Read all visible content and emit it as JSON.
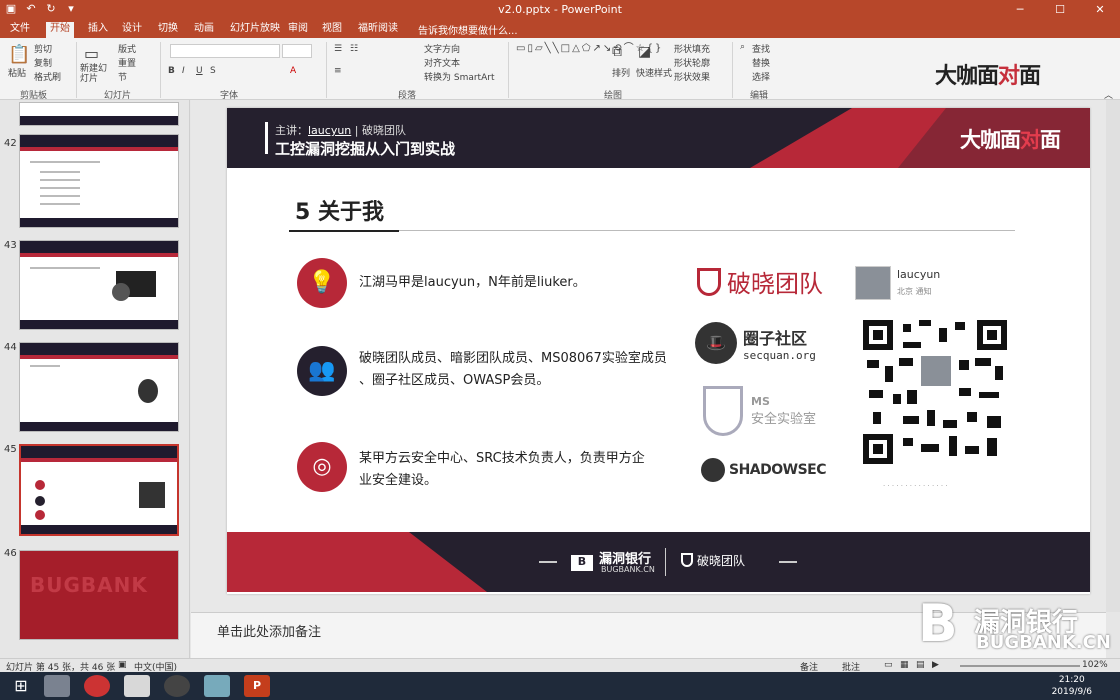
{
  "window": {
    "title": "v2.0.pptx - PowerPoint",
    "qat": [
      "save-icon",
      "undo-icon",
      "redo-icon",
      "customize-icon"
    ],
    "controls": [
      "minimize",
      "maximize",
      "close"
    ]
  },
  "tabs": [
    "文件",
    "开始",
    "插入",
    "设计",
    "切换",
    "动画",
    "幻灯片放映",
    "审阅",
    "视图",
    "福昕阅读"
  ],
  "active_tab": "开始",
  "tell_me": "告诉我你想要做什么...",
  "ribbon": {
    "groups": [
      "剪贴板",
      "幻灯片",
      "字体",
      "段落",
      "绘图",
      "编辑"
    ],
    "buttons": {
      "paste": "粘贴",
      "cut": "剪切",
      "copy": "复制",
      "format_painter": "格式刷",
      "new_slide": "新建幻灯片",
      "layout": "版式",
      "reset": "重置",
      "section": "节",
      "text_direction": "文字方向",
      "align_text": "对齐文本",
      "convert_smartart": "转换为 SmartArt",
      "arrange": "排列",
      "quick_styles": "快速样式",
      "shape_fill": "形状填充",
      "shape_outline": "形状轮廓",
      "shape_effects": "形状效果",
      "find": "查找",
      "replace": "替换",
      "select": "选择"
    }
  },
  "overlay_logo": {
    "part1": "大咖面",
    "part2": "对",
    "part3": "面"
  },
  "thumbnails": [
    {
      "num": "42"
    },
    {
      "num": "43"
    },
    {
      "num": "44"
    },
    {
      "num": "45"
    },
    {
      "num": "46",
      "brand": "BUGBANK"
    }
  ],
  "slide": {
    "host_prefix": "主讲：",
    "host_name": "laucyun",
    "host_sep": " | ",
    "host_team": "破晓团队",
    "course": "工控漏洞挖掘从入门到实战",
    "banner_logo": {
      "part1": "大咖面",
      "part2": "对",
      "part3": "面"
    },
    "section_title": "5 关于我",
    "bullets": [
      {
        "icon": "lightbulb-icon",
        "text": "江湖马甲是laucyun，N年前是liuker。"
      },
      {
        "icon": "people-icon",
        "text1": "破晓团队成员、暗影团队成员、MS08067实验室成员",
        "text2": "、圈子社区成员、OWASP会员。"
      },
      {
        "icon": "target-icon",
        "text1": "某甲方云安全中心、SRC技术负责人，负责甲方企",
        "text2": "业安全建设。"
      }
    ],
    "logos": {
      "team": "破晓团队",
      "quan_title": "圈子社区",
      "quan_url": "secquan.org",
      "ms_title": "MS",
      "ms_sub": "安全实验室",
      "shadow": "SHADOWSEC"
    },
    "profile": {
      "name": "laucyun",
      "sub": "北京 通知"
    },
    "footer": {
      "brand": "漏洞银行",
      "brand_sub": "BUGBANK.CN",
      "team": "破晓团队"
    }
  },
  "notes_placeholder": "单击此处添加备注",
  "watermark": {
    "line1": "漏洞银行",
    "line2": "BUGBANK.CN"
  },
  "status": {
    "slide_info": "幻灯片 第 45 张，共 46 张",
    "language": "中文(中国)",
    "notes": "备注",
    "comments": "批注",
    "zoom": "102%"
  },
  "clock": {
    "time": "21:20",
    "date": "2019/9/6"
  }
}
